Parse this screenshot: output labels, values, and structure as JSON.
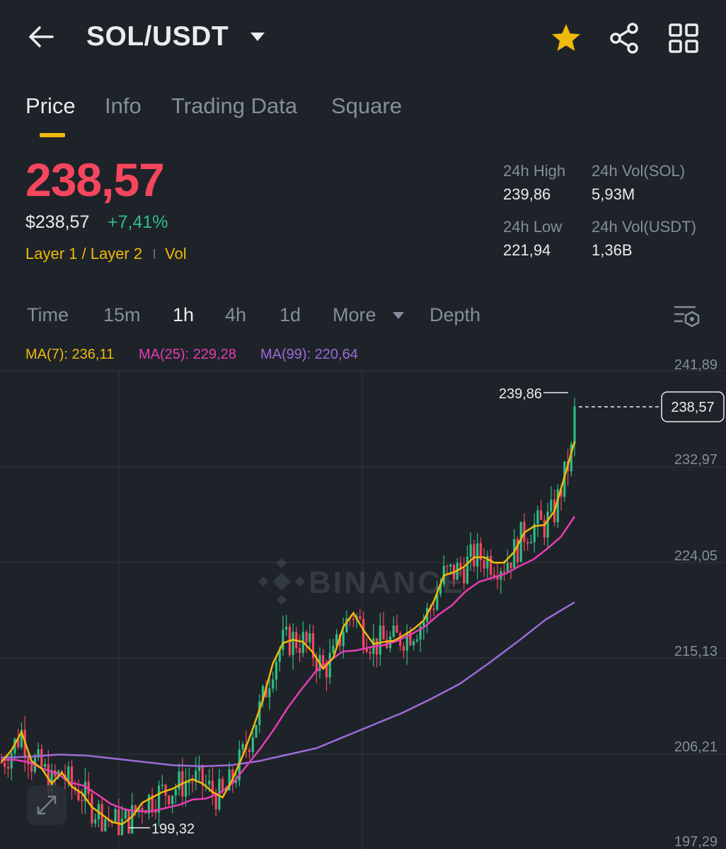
{
  "header": {
    "pair": "SOL/USDT",
    "back_icon": "arrow-left-icon",
    "star_icon": "star-icon",
    "share_icon": "share-icon",
    "grid_icon": "grid-icon",
    "star_color": "#f0b90b"
  },
  "tabs": [
    {
      "label": "Price",
      "active": true
    },
    {
      "label": "Info",
      "active": false
    },
    {
      "label": "Trading Data",
      "active": false
    },
    {
      "label": "Square",
      "active": false
    }
  ],
  "price": {
    "last": "238,57",
    "usd": "$238,57",
    "change": "+7,41%",
    "tag": "Layer 1 / Layer 2",
    "tag2": "Vol",
    "colors": {
      "down": "#f6465d",
      "up": "#2ebd85",
      "accent": "#f0b90b"
    }
  },
  "stats": {
    "high_label": "24h High",
    "high_value": "239,86",
    "vol_sol_label": "24h Vol(SOL)",
    "vol_sol_value": "5,93M",
    "low_label": "24h Low",
    "low_value": "221,94",
    "vol_usdt_label": "24h Vol(USDT)",
    "vol_usdt_value": "1,36B"
  },
  "intervals": {
    "time": "Time",
    "m15": "15m",
    "h1": "1h",
    "h4": "4h",
    "d1": "1d",
    "more": "More",
    "depth": "Depth",
    "active": "1h",
    "settings_icon": "chart-settings-icon"
  },
  "ma": {
    "ma7": "MA(7): 236,11",
    "ma25": "MA(25): 229,28",
    "ma99": "MA(99): 220,64",
    "colors": {
      "ma7": "#f0b90b",
      "ma25": "#e63cb4",
      "ma99": "#9b6cd9"
    }
  },
  "chart": {
    "watermark": "BINANCE",
    "y_ticks": [
      "241,89",
      "232,97",
      "224,05",
      "215,13",
      "206,21",
      "197,29"
    ],
    "high_label": "239,86",
    "low_label": "199,32",
    "current_label": "238,57",
    "expand_icon": "expand-icon"
  },
  "chart_data": {
    "type": "candlestick",
    "y_range": [
      197.29,
      241.89
    ],
    "y_ticks": [
      241.89,
      232.97,
      224.05,
      215.13,
      206.21,
      197.29
    ],
    "interval": "1h",
    "high": 239.86,
    "low": 199.32,
    "last": 238.57,
    "ma7": [
      205.4,
      206.5,
      208.2,
      205.5,
      204.8,
      203.4,
      204.4,
      203.1,
      202.5,
      201.2,
      200.5,
      199.8,
      199.6,
      200.3,
      201.6,
      202.1,
      202.6,
      202.9,
      203.4,
      203.8,
      203.4,
      202.6,
      202.1,
      203.8,
      206.0,
      208.5,
      211.2,
      214.6,
      216.5,
      216.8,
      216.6,
      215.6,
      214.1,
      215.1,
      218.0,
      219.3,
      217.7,
      216.4,
      216.6,
      216.7,
      217.2,
      217.8,
      218.6,
      220.4,
      222.8,
      223.1,
      223.6,
      224.5,
      224.5,
      224.0,
      224.0,
      225.0,
      226.8,
      227.4,
      227.5,
      228.8,
      232.0,
      235.3
    ],
    "ma25": [
      205.6,
      205.6,
      205.4,
      204.8,
      204.4,
      203.5,
      203.2,
      202.4,
      201.5,
      201.0,
      200.8,
      200.8,
      201.1,
      201.4,
      201.9,
      202.0,
      202.5,
      203.5,
      205.1,
      206.7,
      208.5,
      210.5,
      212.2,
      213.8,
      214.8,
      215.7,
      215.8,
      216.1,
      216.3,
      216.7,
      217.3,
      218.0,
      219.1,
      220.0,
      221.3,
      222.2,
      222.6,
      223.0,
      223.7,
      224.3,
      225.3,
      226.4,
      228.3
    ],
    "ma99": [
      205.8,
      205.9,
      206.1,
      206.0,
      205.7,
      205.4,
      205.1,
      205.0,
      205.1,
      205.5,
      206.1,
      206.7,
      207.8,
      208.9,
      210.0,
      211.3,
      212.7,
      214.6,
      216.6,
      218.7,
      220.3
    ],
    "series_colors": {
      "up": "#2ebd85",
      "down": "#f6465d"
    }
  }
}
